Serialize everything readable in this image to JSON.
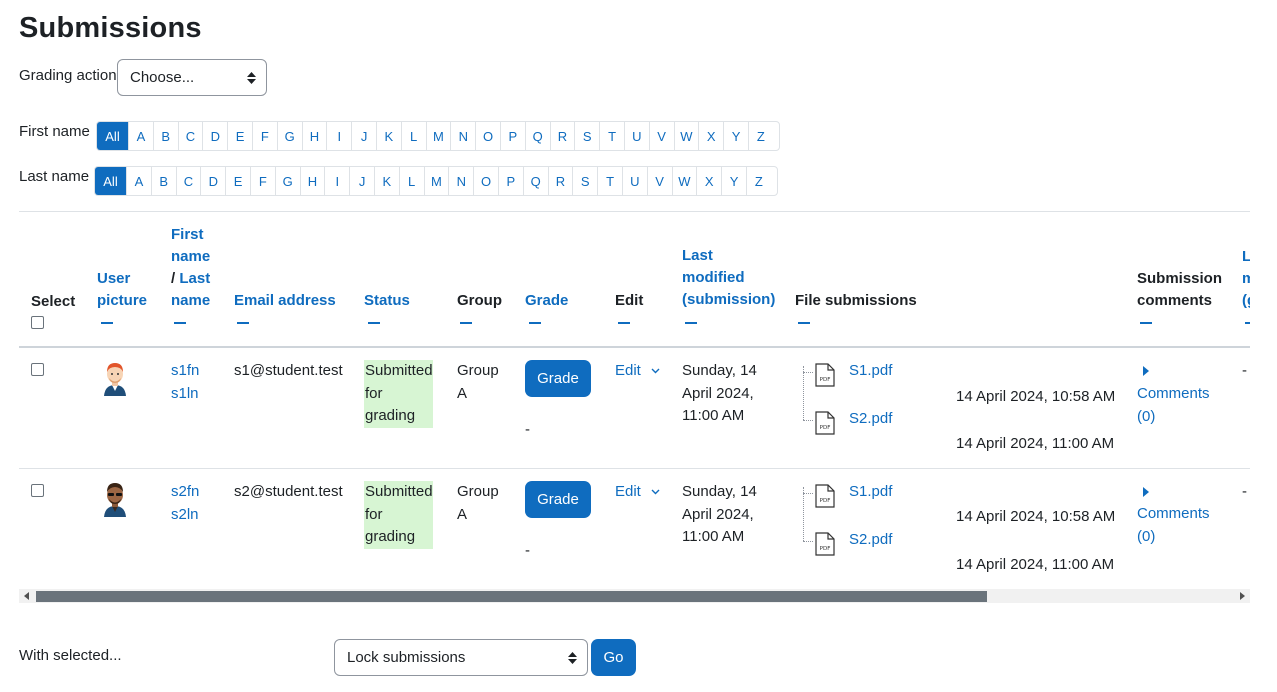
{
  "page": {
    "title": "Submissions"
  },
  "grading_action": {
    "label": "Grading action",
    "value": "Choose..."
  },
  "filters": {
    "first_name_label": "First name",
    "last_name_label": "Last name",
    "all": "All",
    "letters": [
      "A",
      "B",
      "C",
      "D",
      "E",
      "F",
      "G",
      "H",
      "I",
      "J",
      "K",
      "L",
      "M",
      "N",
      "O",
      "P",
      "Q",
      "R",
      "S",
      "T",
      "U",
      "V",
      "W",
      "X",
      "Y",
      "Z"
    ]
  },
  "table": {
    "headers": {
      "select": "Select",
      "user_picture_1": "User",
      "user_picture_2": "picture",
      "first_name_1": "First",
      "first_name_2": "name",
      "slash": "/ ",
      "last_name_1": "Last",
      "last_name_2": "name",
      "email": "Email address",
      "status": "Status",
      "group": "Group",
      "grade": "Grade",
      "edit": "Edit",
      "last_modified_1": "Last",
      "last_modified_2": "modified",
      "last_modified_3": "(submission)",
      "file_submissions": "File submissions",
      "submission_comments_1": "Submission",
      "submission_comments_2": "comments",
      "cut_1": "L",
      "cut_2": "m",
      "cut_3": "(g"
    },
    "rows": [
      {
        "first_name": "s1fn",
        "last_name": "s1ln",
        "email": "s1@student.test",
        "status_1": "Submitted",
        "status_2": "for",
        "status_3": "grading",
        "group_1": "Group",
        "group_2": "A",
        "grade_button": "Grade",
        "grade_value": "-",
        "edit": "Edit",
        "modified_1": "Sunday, 14",
        "modified_2": "April 2024,",
        "modified_3": "11:00 AM",
        "files": [
          {
            "name": "S1.pdf",
            "time": "14 April 2024, 10:58 AM"
          },
          {
            "name": "S2.pdf",
            "time": "14 April 2024, 11:00 AM"
          }
        ],
        "comments_1": "Comments",
        "comments_2": "(0)",
        "trailing": "-"
      },
      {
        "first_name": "s2fn",
        "last_name": "s2ln",
        "email": "s2@student.test",
        "status_1": "Submitted",
        "status_2": "for",
        "status_3": "grading",
        "group_1": "Group",
        "group_2": "A",
        "grade_button": "Grade",
        "grade_value": "-",
        "edit": "Edit",
        "modified_1": "Sunday, 14",
        "modified_2": "April 2024,",
        "modified_3": "11:00 AM",
        "files": [
          {
            "name": "S1.pdf",
            "time": "14 April 2024, 10:58 AM"
          },
          {
            "name": "S2.pdf",
            "time": "14 April 2024, 11:00 AM"
          }
        ],
        "comments_1": "Comments",
        "comments_2": "(0)",
        "trailing": "-"
      }
    ]
  },
  "bulk": {
    "label": "With selected...",
    "value": "Lock submissions",
    "go": "Go"
  },
  "colors": {
    "accent": "#0f6cbf",
    "status_bg": "#d7f5d3",
    "border": "#dee2e6"
  },
  "icons": [
    "caret-updown-icon",
    "pdf-file-icon",
    "chevron-down-icon",
    "expand-triangle-icon",
    "avatar-red-hair",
    "avatar-sunglasses"
  ]
}
